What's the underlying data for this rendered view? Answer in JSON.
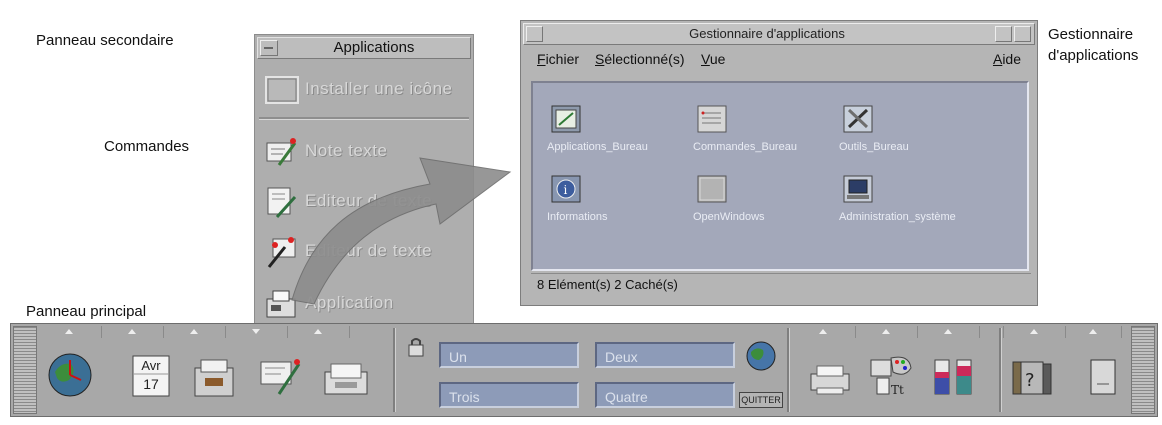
{
  "callouts": {
    "subpanel": "Panneau secondaire",
    "commands": "Commandes",
    "main_panel": "Panneau principal",
    "app_manager": "Gestionnaire d'applications"
  },
  "subpanel": {
    "title": "Applications",
    "items": [
      {
        "label": "Installer une icône",
        "icon": "blank-icon-drop"
      },
      {
        "label": "Note texte",
        "icon": "text-note-icon"
      },
      {
        "label": "Editeur de texte",
        "icon": "text-editor-icon"
      },
      {
        "label": "Editeur de texte",
        "icon": "text-editor-pen-icon"
      },
      {
        "label": "Application",
        "icon": "application-icon"
      }
    ]
  },
  "app_manager": {
    "title": "Gestionnaire d'applications",
    "menu": [
      "Fichier",
      "Sélectionné(s)",
      "Vue",
      "Aide"
    ],
    "items": [
      {
        "label": "Applications_Bureau",
        "icon": "desktop-apps-folder-icon"
      },
      {
        "label": "Commandes_Bureau",
        "icon": "desktop-commands-folder-icon"
      },
      {
        "label": "Outils_Bureau",
        "icon": "desktop-tools-folder-icon"
      },
      {
        "label": "Informations",
        "icon": "info-folder-icon"
      },
      {
        "label": "OpenWindows",
        "icon": "openwindows-folder-icon"
      },
      {
        "label": "Administration_système",
        "icon": "system-admin-folder-icon"
      }
    ],
    "status": "8 Elément(s) 2 Caché(s)"
  },
  "front_panel": {
    "calendar": {
      "month": "Avr",
      "day": "17"
    },
    "workspaces": [
      "Un",
      "Deux",
      "Trois",
      "Quatre"
    ],
    "exit_label": "QUITTER"
  },
  "colors": {
    "panel_gray": "#a8a8a8",
    "viewport_blue": "#a3a8ba",
    "workspace_blue": "#8d9bb8",
    "arrow_gray": "#8c8c8c"
  }
}
